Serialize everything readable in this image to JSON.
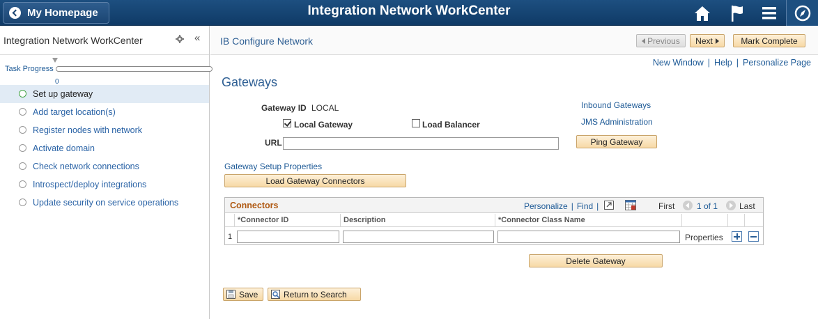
{
  "banner": {
    "home_label": "My Homepage",
    "title": "Integration Network WorkCenter",
    "icons": [
      "home-icon",
      "flag-icon",
      "menu-icon",
      "navbar-icon"
    ]
  },
  "left_panel": {
    "title": "Integration Network WorkCenter",
    "progress_label": "Task Progress",
    "progress_value": "0",
    "progress_fraction": 0,
    "tasks": [
      {
        "label": "Set up gateway",
        "active": true
      },
      {
        "label": "Add target location(s)",
        "active": false
      },
      {
        "label": "Register nodes with network",
        "active": false
      },
      {
        "label": "Activate domain",
        "active": false
      },
      {
        "label": "Check network connections",
        "active": false
      },
      {
        "label": "Introspect/deploy integrations",
        "active": false
      },
      {
        "label": "Update security on service operations",
        "active": false
      }
    ]
  },
  "content": {
    "crumb": "IB Configure Network",
    "previous_label": "Previous",
    "next_label": "Next",
    "mark_complete_label": "Mark Complete",
    "links": {
      "new_window": "New Window",
      "help": "Help",
      "personalize_page": "Personalize Page"
    },
    "heading": "Gateways",
    "gateway_id_label": "Gateway ID",
    "gateway_id_value": "LOCAL",
    "local_gateway_label": "Local Gateway",
    "local_gateway_checked": true,
    "load_balancer_label": "Load Balancer",
    "load_balancer_checked": false,
    "url_label": "URL",
    "url_value": "",
    "inbound_gateways": "Inbound Gateways",
    "jms_administration": "JMS Administration",
    "ping_gateway": "Ping Gateway",
    "setup_properties": "Gateway Setup Properties",
    "load_connectors": "Load Gateway Connectors",
    "delete_gateway": "Delete Gateway",
    "save": "Save",
    "return_to_search": "Return to Search"
  },
  "grid": {
    "title": "Connectors",
    "personalize": "Personalize",
    "find": "Find",
    "first": "First",
    "count": "1 of 1",
    "last": "Last",
    "columns": [
      "*Connector ID",
      "Description",
      "*Connector Class Name"
    ],
    "rows": [
      {
        "num": "1",
        "connector_id": "",
        "description": "",
        "class_name": "",
        "properties": "Properties"
      }
    ]
  },
  "colors": {
    "banner": "#1d4f80",
    "link": "#1f5b97",
    "grid_title": "#b05a13",
    "button_fill": "#f7d9a6"
  }
}
